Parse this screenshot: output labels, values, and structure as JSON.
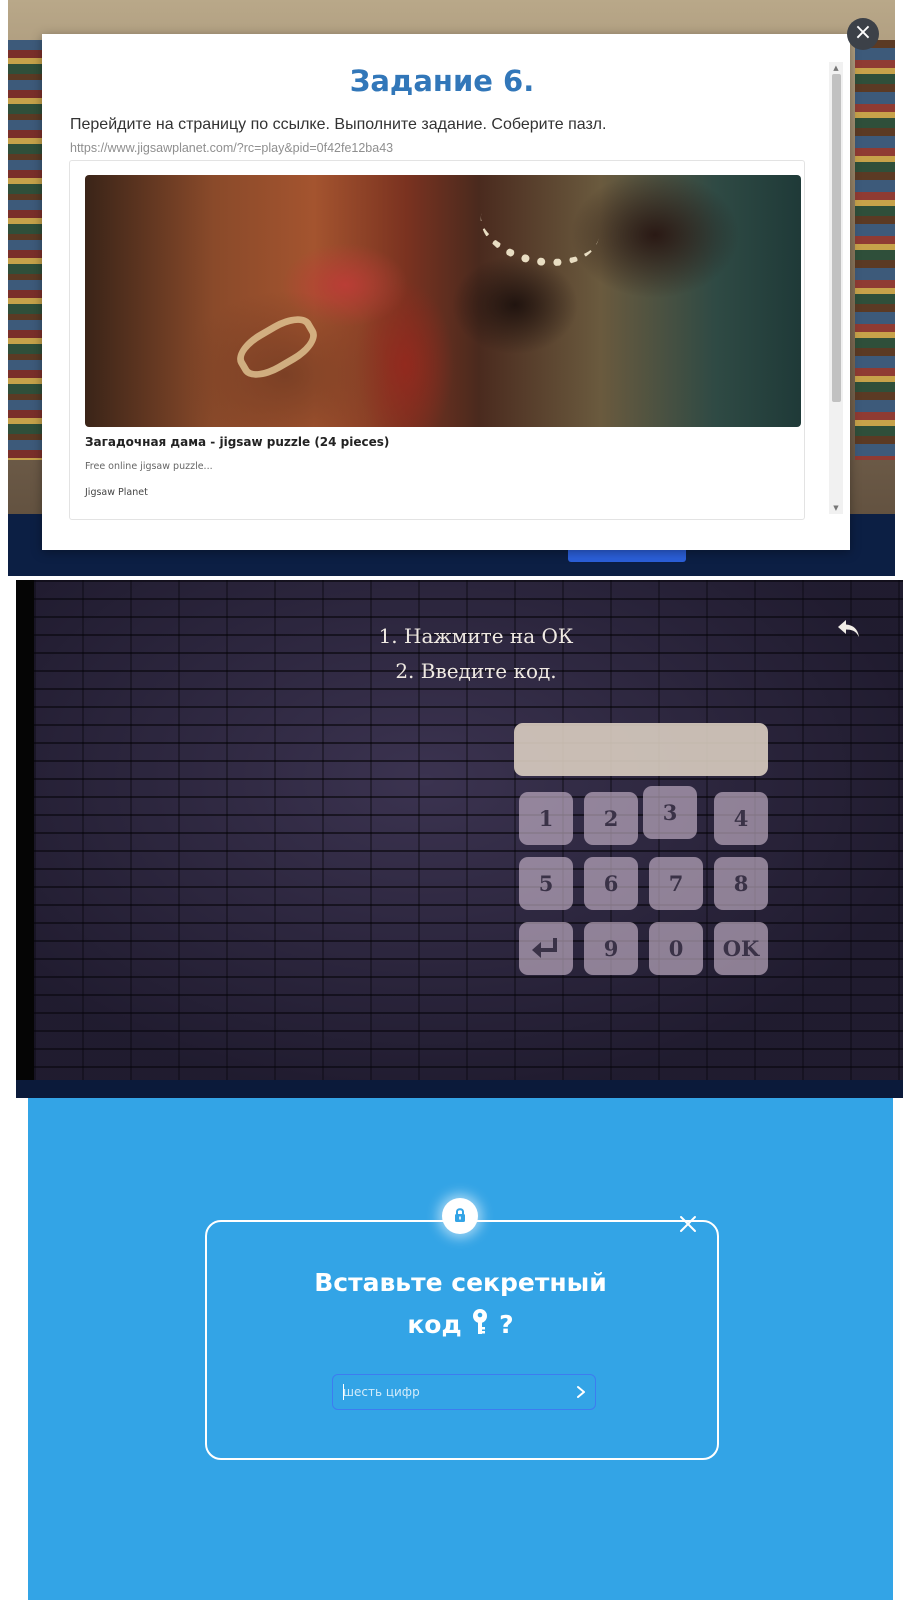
{
  "task_modal": {
    "title": "Задание 6.",
    "instruction": "Перейдите на страницу по ссылке. Выполните задание. Соберите пазл.",
    "url": "https://www.jigsawplanet.com/?rc=play&pid=0f42fe12ba43",
    "preview": {
      "title": "Загадочная дама - jigsaw puzzle (24 pieces)",
      "description": "Free online jigsaw puzzle...",
      "site": "Jigsaw Planet"
    },
    "close_symbol": "×"
  },
  "keypad_screen": {
    "instruction_1": "1. Нажмите на ОК",
    "instruction_2": "2. Введите код.",
    "keys": {
      "k1": "1",
      "k2": "2",
      "k3": "3",
      "k4": "4",
      "k5": "5",
      "k6": "6",
      "k7": "7",
      "k8": "8",
      "k9": "9",
      "k0": "0",
      "ok": "OK"
    },
    "icons": [
      "back-arrow-icon",
      "enter-icon"
    ]
  },
  "secret_code": {
    "heading_line1": "Вставьте секретный",
    "heading_line2_word": "код",
    "heading_line2_mark": "?",
    "input_placeholder": "шесть цифр",
    "icons": [
      "lock-icon",
      "key-icon",
      "close-icon",
      "chevron-right-icon"
    ],
    "colors": {
      "background": "#33a4e6",
      "accent": "#3d7cf0"
    }
  }
}
